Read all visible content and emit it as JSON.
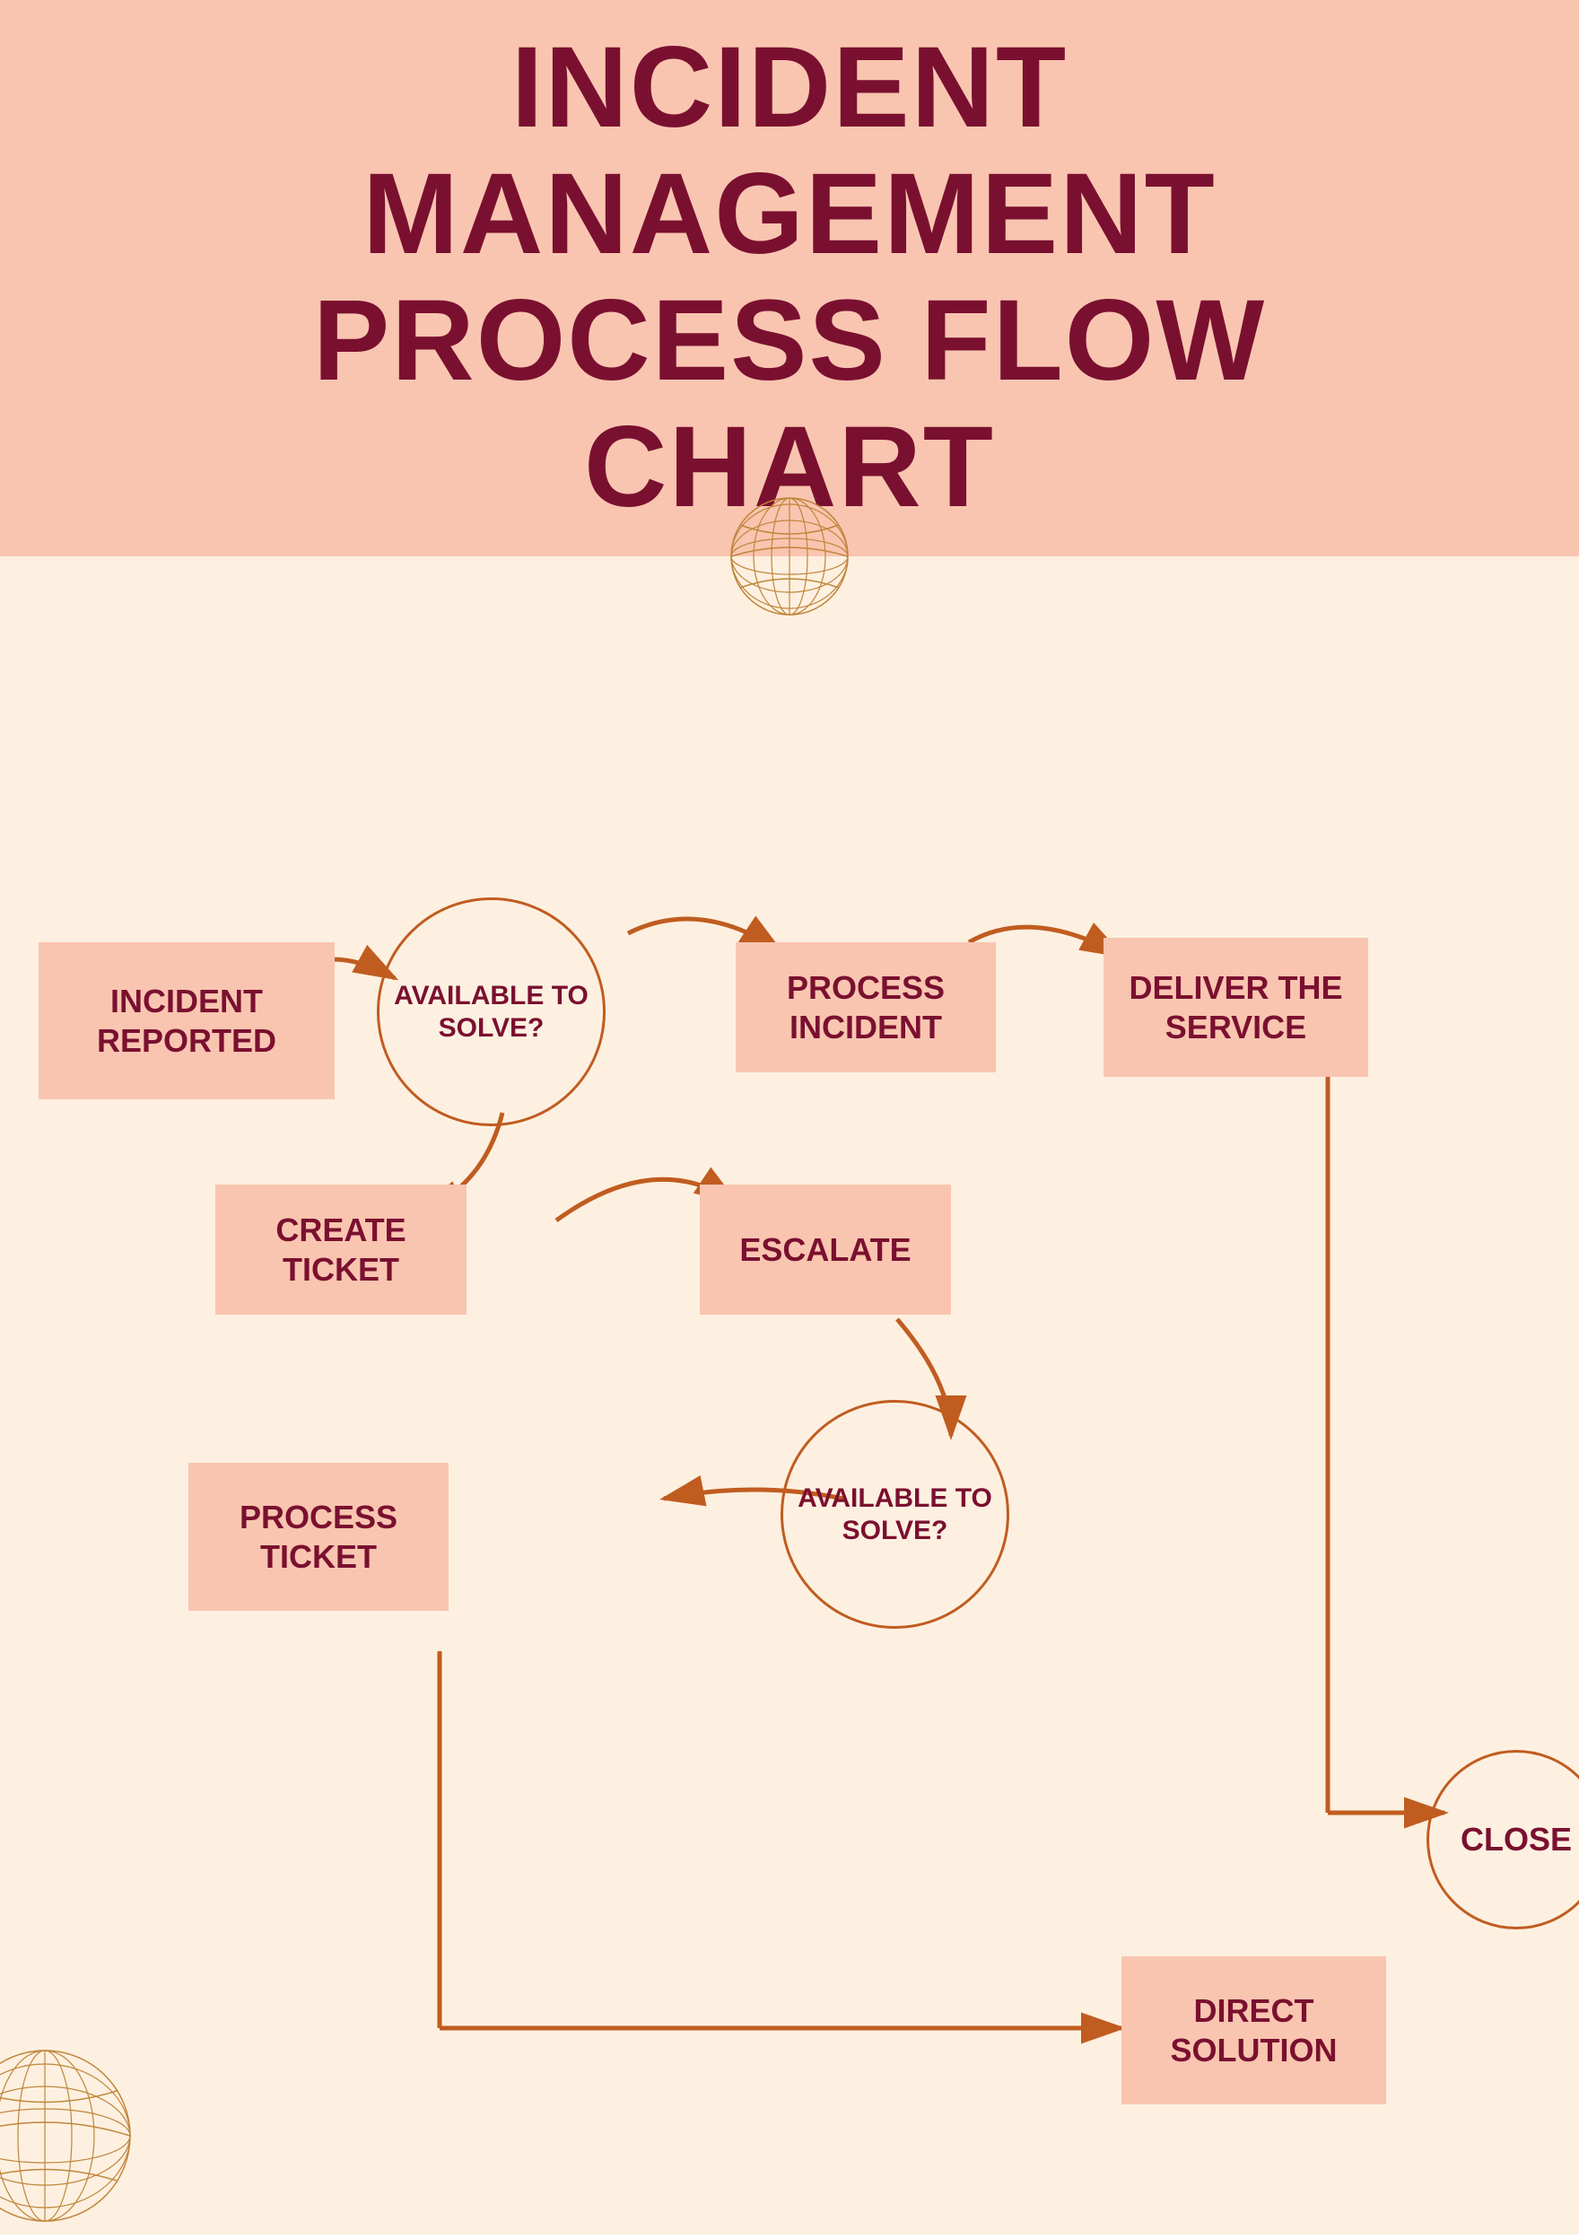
{
  "title": {
    "line1": "INCIDENT",
    "line2": "MANAGEMENT",
    "line3": "PROCESS FLOW",
    "line4": "CHART"
  },
  "nodes": {
    "incident_reported": "INCIDENT REPORTED",
    "available_to_solve_1": "AVAILABLE TO SOLVE?",
    "process_incident": "PROCESS INCIDENT",
    "deliver_the_service": "DELIVER THE SERVICE",
    "create_ticket": "CREATE TICKET",
    "escalate": "ESCALATE",
    "available_to_solve_2": "AVAILABLE TO SOLVE?",
    "process_ticket": "PROCESS TICKET",
    "close": "CLOSE",
    "direct_solution": "DIRECT SOLUTION"
  },
  "colors": {
    "header_bg": "#f9c5b0",
    "body_bg": "#fdf0e0",
    "title_color": "#7a1030",
    "node_bg": "#f9c5b0",
    "circle_border": "#c05c20",
    "arrow_color": "#c05c20",
    "node_text": "#7a1030"
  }
}
